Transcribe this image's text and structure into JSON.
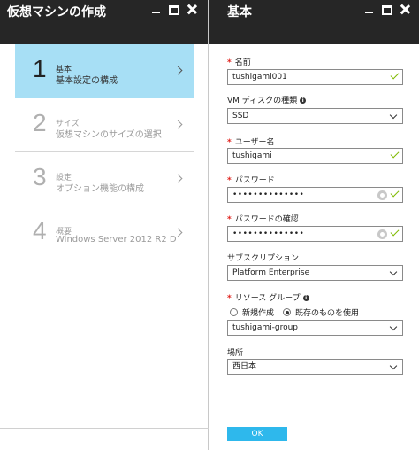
{
  "left_blade": {
    "title": "仮想マシンの作成",
    "steps": [
      {
        "number": "1",
        "small": "基本",
        "text": "基本設定の構成"
      },
      {
        "number": "2",
        "small": "サイズ",
        "text": "仮想マシンのサイズの選択"
      },
      {
        "number": "3",
        "small": "設定",
        "text": "オプション機能の構成"
      },
      {
        "number": "4",
        "small": "概要",
        "text": "Windows Server 2012 R2 D..."
      }
    ]
  },
  "right_blade": {
    "title": "基本",
    "required_mark": "*",
    "info_glyph": "i",
    "name": {
      "label": "名前",
      "value": "tushigami001"
    },
    "disk_type": {
      "label": "VM ディスクの種類",
      "value": "SSD"
    },
    "username": {
      "label": "ユーザー名",
      "value": "tushigami"
    },
    "password": {
      "label": "パスワード",
      "value": "••••••••••••••"
    },
    "password_confirm": {
      "label": "パスワードの確認",
      "value": "••••••••••••••"
    },
    "subscription": {
      "label": "サブスクリプション",
      "value": "Platform Enterprise"
    },
    "resource_group": {
      "label": "リソース グループ",
      "option_new": "新規作成",
      "option_existing": "既存のものを使用",
      "value": "tushigami-group"
    },
    "location": {
      "label": "場所",
      "value": "西日本"
    },
    "ok_label": "OK"
  },
  "icons": {
    "minimize": "minimize-icon",
    "maximize": "maximize-icon",
    "close": "close-icon",
    "chevron": "chevron-right-icon",
    "check": "check-icon",
    "reveal": "eye-reveal-icon",
    "dropdown": "chevron-down-icon",
    "info": "info-icon"
  },
  "colors": {
    "header_bg": "#262626",
    "active_step": "#a7dff5",
    "required": "#e0201b",
    "valid_check": "#7fba00",
    "ok_button": "#2eb8ec"
  }
}
